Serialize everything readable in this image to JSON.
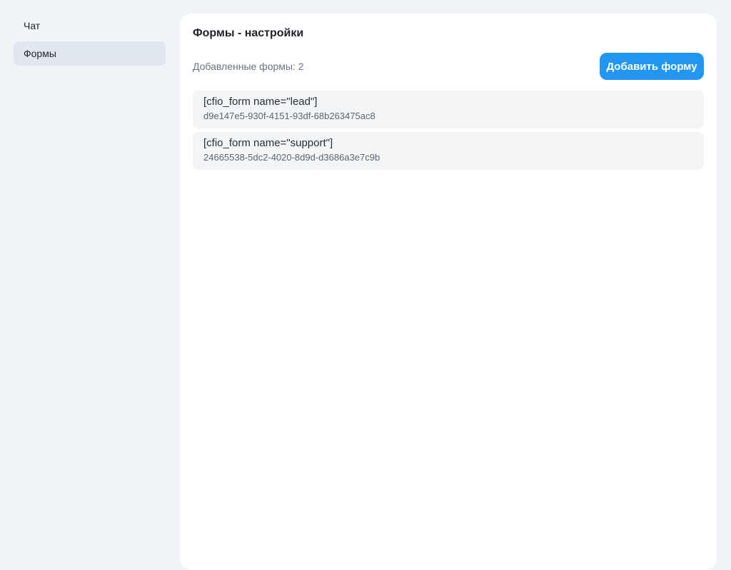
{
  "sidebar": {
    "items": [
      {
        "label": "Чат"
      },
      {
        "label": "Формы",
        "active": true
      }
    ]
  },
  "main": {
    "title": "Формы - настройки",
    "count_label": "Добавленные формы: 2",
    "add_button": "Добавить форму",
    "forms": [
      {
        "shortcode": "[cfio_form name=\"lead\"]",
        "id": "d9e147e5-930f-4151-93df-68b263475ac8"
      },
      {
        "shortcode": "[cfio_form name=\"support\"]",
        "id": "24665538-5dc2-4020-8d9d-d3686a3e7c9b"
      }
    ]
  },
  "colors": {
    "accent": "#2196f3",
    "background": "#f0f3f8"
  }
}
